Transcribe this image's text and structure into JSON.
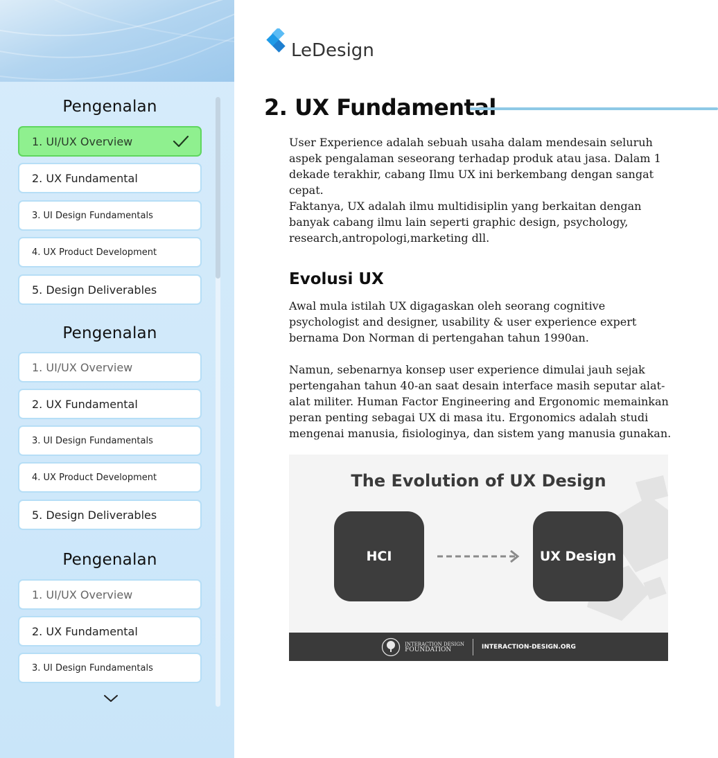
{
  "brand": {
    "name": "LeDesign",
    "colors": {
      "accent": "#8ec9e6",
      "logo": "#1e9be8",
      "active": "#8ff08f"
    }
  },
  "sidebar": {
    "sections": [
      {
        "title": "Pengenalan",
        "items": [
          {
            "label": "1. UI/UX Overview",
            "state": "completed"
          },
          {
            "label": "2. UX Fundamental",
            "state": "default"
          },
          {
            "label": "3. UI Design Fundamentals",
            "state": "default"
          },
          {
            "label": "4. UX Product Development",
            "state": "default"
          },
          {
            "label": "5. Design Deliverables",
            "state": "default"
          }
        ]
      },
      {
        "title": "Pengenalan",
        "items": [
          {
            "label": "1. UI/UX Overview",
            "state": "default"
          },
          {
            "label": "2. UX Fundamental",
            "state": "default"
          },
          {
            "label": "3. UI Design Fundamentals",
            "state": "default"
          },
          {
            "label": "4. UX Product Development",
            "state": "default"
          },
          {
            "label": "5. Design Deliverables",
            "state": "default"
          }
        ]
      },
      {
        "title": "Pengenalan",
        "items": [
          {
            "label": "1. UI/UX Overview",
            "state": "default"
          },
          {
            "label": "2. UX Fundamental",
            "state": "default"
          },
          {
            "label": "3. UI Design Fundamentals",
            "state": "default"
          }
        ]
      }
    ],
    "expand_icon": "chevron-down-icon"
  },
  "main": {
    "title": "2. UX Fundamental",
    "paragraphs": [
      "User Experience adalah sebuah usaha dalam mendesain seluruh aspek pengalaman seseorang terhadap produk atau jasa. Dalam 1 dekade terakhir, cabang Ilmu UX ini berkembang dengan sangat cepat.",
      "Faktanya, UX adalah ilmu multidisiplin yang berkaitan dengan banyak cabang ilmu lain seperti graphic design, psychology, research,antropologi,marketing dll."
    ],
    "subheading": "Evolusi UX",
    "paragraphs2": [
      "Awal mula istilah UX digagaskan oleh seorang cognitive psychologist and designer, usability & user experience expert bernama Don Norman di pertengahan tahun 1990an.",
      "Namun, sebenarnya konsep user experience dimulai jauh sejak pertengahan tahun 40-an saat desain interface masih seputar alat-alat militer. Human Factor Engineering and Ergonomic memainkan peran penting sebagai UX di masa itu. Ergonomics adalah studi mengenai manusia, fisiologinya, dan sistem yang manusia gunakan."
    ],
    "figure": {
      "title": "The Evolution of UX Design",
      "from": "HCI",
      "to": "UX Design",
      "footer_org_line1": "INTERACTION DESIGN",
      "footer_org_line2": "FOUNDATION",
      "footer_url": "INTERACTION-DESIGN.ORG"
    }
  }
}
